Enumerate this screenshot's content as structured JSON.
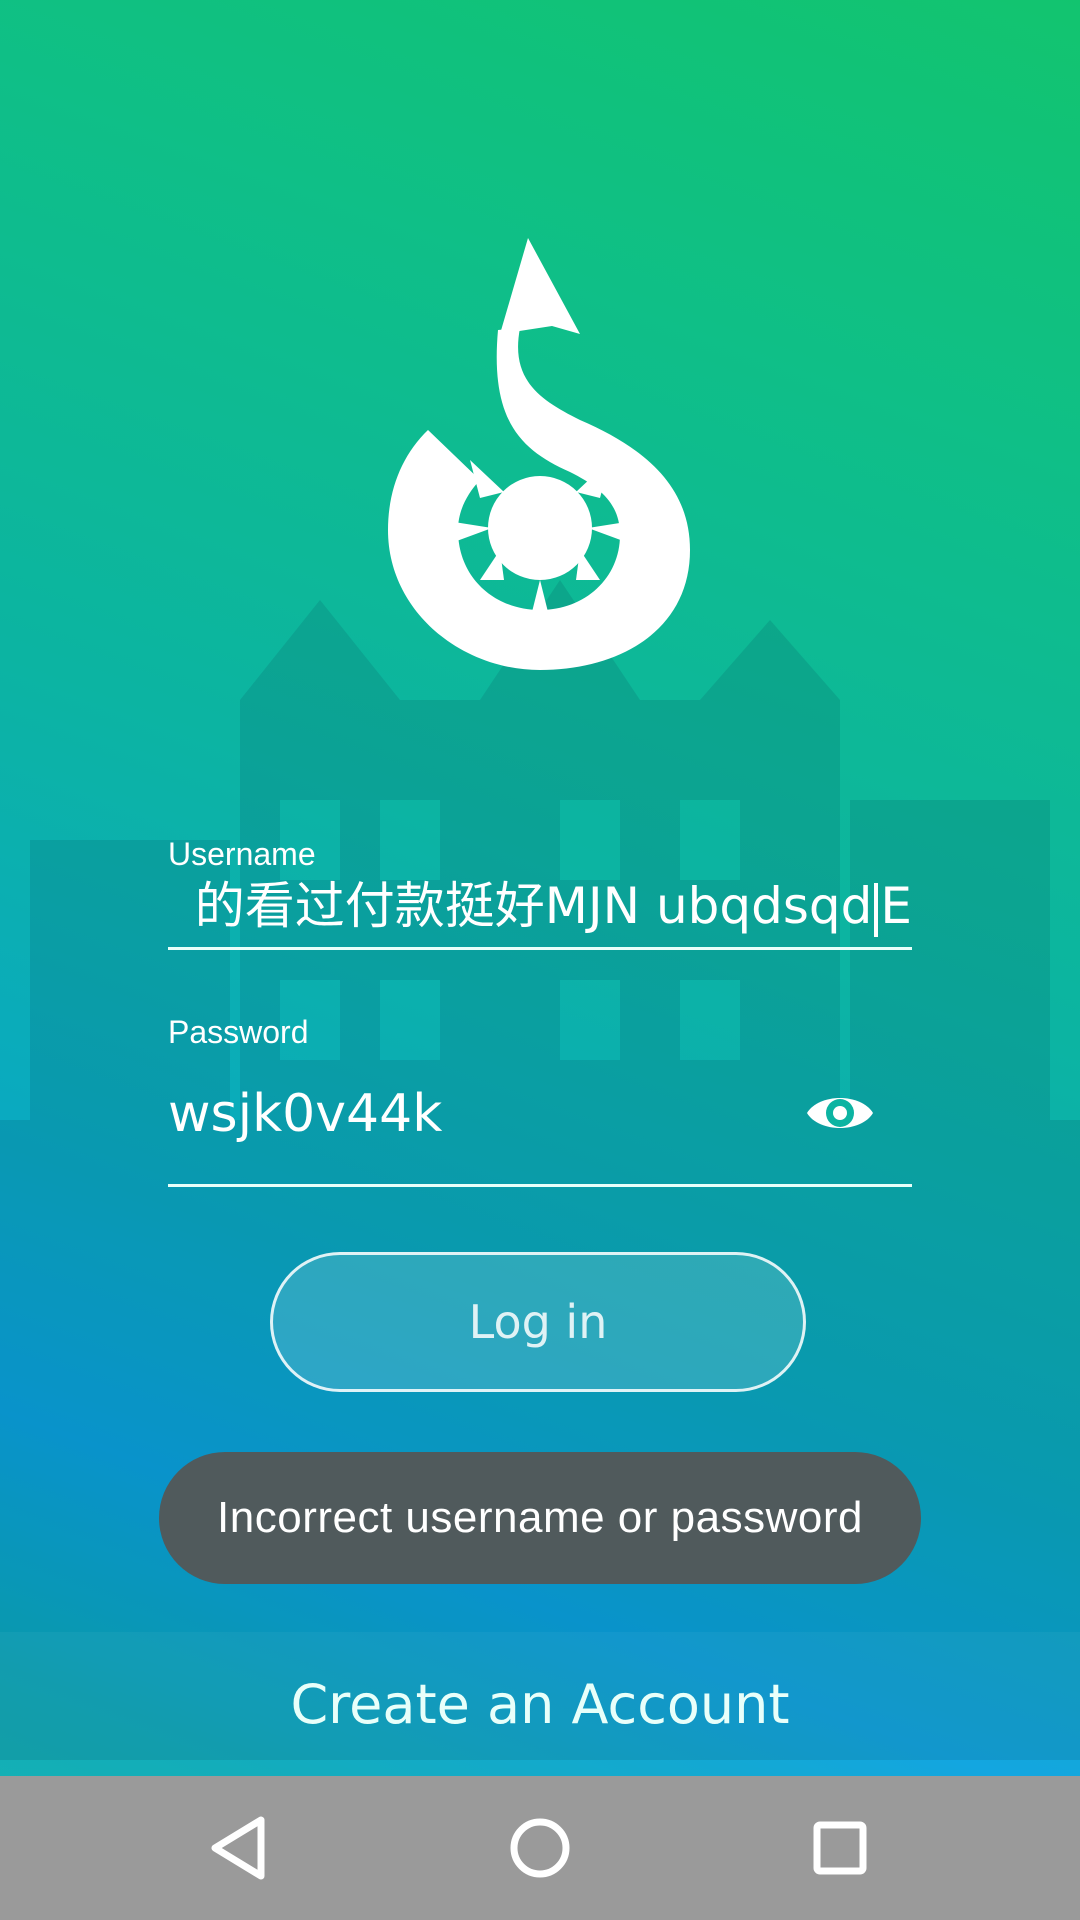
{
  "login": {
    "username_label": "Username",
    "username_value": "的看过付款挺好MJN ubqdsqd",
    "username_value_tail": "E",
    "password_label": "Password",
    "password_value": "wsjk0v44k",
    "password_visibility_icon": "eye-icon",
    "login_button": "Log in"
  },
  "toast": {
    "message": "Incorrect username or password"
  },
  "footer": {
    "create_account": "Create an Account"
  },
  "navigation": {
    "back_icon": "back-triangle-icon",
    "home_icon": "home-circle-icon",
    "recents_icon": "recents-square-icon"
  },
  "colors": {
    "gradient_top": "#12c46f",
    "gradient_mid": "#0cb4a2",
    "gradient_blue": "#0aa3df",
    "toast_bg": "#505a5c",
    "navbar_bg": "#9a9a9a"
  }
}
